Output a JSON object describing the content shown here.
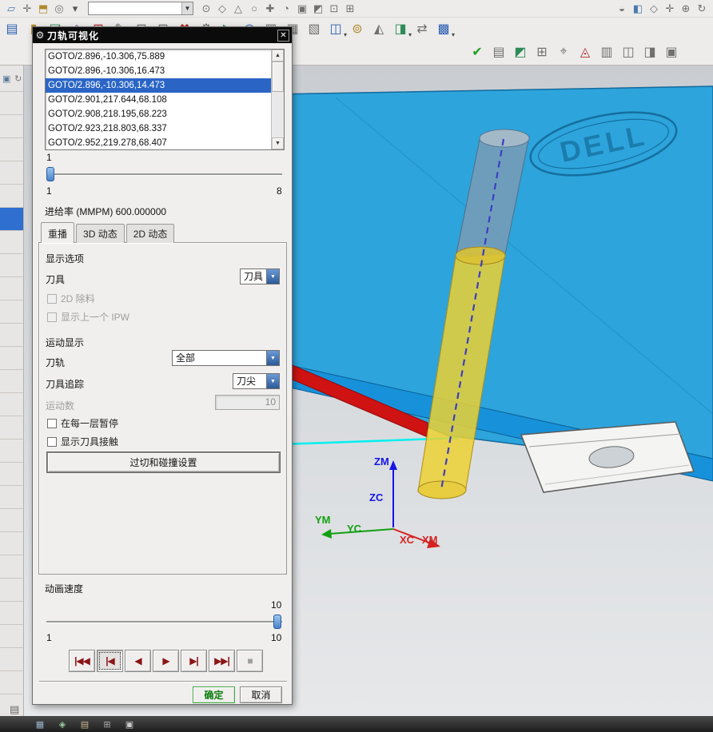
{
  "toolbars": {
    "row1_combo_value": "",
    "row1_left": [
      {
        "name": "sketch-icon",
        "glyph": "▱",
        "color": "#4a7ab0"
      },
      {
        "name": "datum-csys-icon",
        "glyph": "✛",
        "color": "#707070"
      },
      {
        "name": "extrude-icon",
        "glyph": "⬒",
        "color": "#b08a30"
      },
      {
        "name": "hole-icon",
        "glyph": "◎",
        "color": "#707070"
      },
      {
        "name": "feature-more-icon",
        "glyph": "▾",
        "color": "#555"
      }
    ],
    "row1_mid": [
      {
        "name": "snap-point-icon",
        "glyph": "⊙",
        "color": "#707070"
      },
      {
        "name": "snap-endpoint-icon",
        "glyph": "◇",
        "color": "#707070"
      },
      {
        "name": "snap-midpoint-icon",
        "glyph": "△",
        "color": "#707070"
      },
      {
        "name": "snap-center-icon",
        "glyph": "○",
        "color": "#707070"
      },
      {
        "name": "snap-intersection-icon",
        "glyph": "✚",
        "color": "#707070"
      },
      {
        "name": "snap-quadrant-icon",
        "glyph": "◔",
        "color": "#707070"
      },
      {
        "name": "snap-node-icon",
        "glyph": "▣",
        "color": "#707070"
      },
      {
        "name": "snap-edge-icon",
        "glyph": "◩",
        "color": "#707070"
      },
      {
        "name": "snap-face-icon",
        "glyph": "⊡",
        "color": "#707070"
      },
      {
        "name": "snap-grid-icon",
        "glyph": "⊞",
        "color": "#707070"
      }
    ],
    "row1_right": [
      {
        "name": "orient-view-icon",
        "glyph": "◒",
        "color": "#707070"
      },
      {
        "name": "shaded-view-icon",
        "glyph": "◧",
        "color": "#4a7ab0"
      },
      {
        "name": "wireframe-view-icon",
        "glyph": "◇",
        "color": "#707070"
      },
      {
        "name": "pan-icon",
        "glyph": "✛",
        "color": "#707070"
      },
      {
        "name": "zoom-icon",
        "glyph": "⊕",
        "color": "#707070"
      },
      {
        "name": "rotate-view-icon",
        "glyph": "↻",
        "color": "#707070"
      }
    ],
    "row2": [
      {
        "name": "create-program-icon",
        "glyph": "▤",
        "color": "#2b5fb4"
      },
      {
        "name": "create-tool-icon",
        "glyph": "▮",
        "color": "#b08a30"
      },
      {
        "name": "create-geometry-icon",
        "glyph": "◪",
        "color": "#2e8b57"
      },
      {
        "name": "create-method-icon",
        "glyph": "◈",
        "color": "#8a4ab0"
      },
      {
        "name": "create-operation-icon",
        "glyph": "⊞",
        "color": "#b03030"
      },
      {
        "name": "edit-object-icon",
        "glyph": "✎",
        "color": "#707070"
      },
      {
        "name": "copy-object-icon",
        "glyph": "⊟",
        "color": "#707070"
      },
      {
        "name": "paste-object-icon",
        "glyph": "⊡",
        "color": "#707070"
      },
      {
        "name": "delete-object-icon",
        "glyph": "✖",
        "color": "#b03030"
      },
      {
        "name": "generate-toolpath-icon",
        "glyph": "⚙",
        "color": "#707070"
      },
      {
        "name": "verify-toolpath-icon",
        "glyph": "▶",
        "color": "#2e8b57",
        "caret": true
      },
      {
        "name": "simulate-machine-icon",
        "glyph": "◉",
        "color": "#2b5fb4"
      },
      {
        "name": "postprocess-icon",
        "glyph": "▥",
        "color": "#707070"
      },
      {
        "name": "shop-documentation-icon",
        "glyph": "▦",
        "color": "#707070"
      },
      {
        "name": "list-toolpath-icon",
        "glyph": "▧",
        "color": "#707070"
      },
      {
        "name": "machine-sim-icon",
        "glyph": "◫",
        "color": "#2b5fb4",
        "caret": true
      },
      {
        "name": "feeds-speeds-icon",
        "glyph": "⊚",
        "color": "#b08a30"
      },
      {
        "name": "tool-display-icon",
        "glyph": "◭",
        "color": "#707070"
      },
      {
        "name": "workpiece-icon",
        "glyph": "◨",
        "color": "#2e8b57",
        "caret": true
      },
      {
        "name": "transform-path-icon",
        "glyph": "⇄",
        "color": "#707070"
      },
      {
        "name": "output-cls-icon",
        "glyph": "▩",
        "color": "#2b5fb4",
        "caret": true
      }
    ],
    "row3": [
      {
        "name": "accept-icon",
        "glyph": "✔",
        "color": "#1e9e1e"
      },
      {
        "name": "layer-settings-icon",
        "glyph": "▤",
        "color": "#707070"
      },
      {
        "name": "group-icon",
        "glyph": "◩",
        "color": "#2e8b57"
      },
      {
        "name": "grid-icon",
        "glyph": "⊞",
        "color": "#707070"
      },
      {
        "name": "target-point-icon",
        "glyph": "⌖",
        "color": "#707070"
      },
      {
        "name": "flag-icon",
        "glyph": "◬",
        "color": "#b03030"
      },
      {
        "name": "note-icon",
        "glyph": "▥",
        "color": "#707070"
      },
      {
        "name": "info-icon",
        "glyph": "◫",
        "color": "#707070"
      },
      {
        "name": "measure-icon",
        "glyph": "◨",
        "color": "#707070"
      },
      {
        "name": "display-mode-icon",
        "glyph": "▣",
        "color": "#707070"
      }
    ]
  },
  "sidebar": {
    "row_count": 27,
    "selected_row": 5,
    "header_icons": [
      {
        "name": "roles-icon",
        "glyph": "▣",
        "color": "#5a7a9a"
      },
      {
        "name": "history-icon",
        "glyph": "↻",
        "color": "#777777"
      }
    ]
  },
  "statusbar": {
    "icons": [
      {
        "name": "status-select-icon",
        "glyph": "▦",
        "color": "#9ab4cc"
      },
      {
        "name": "status-snap-icon",
        "glyph": "◈",
        "color": "#9acc9a"
      },
      {
        "name": "status-layer-icon",
        "glyph": "▤",
        "color": "#ccb48a"
      },
      {
        "name": "status-grid-icon",
        "glyph": "⊞",
        "color": "#aaaaaa"
      },
      {
        "name": "status-message-icon",
        "glyph": "▣",
        "color": "#cccccc"
      }
    ]
  },
  "dialog": {
    "title": "刀轨可视化",
    "goto_lines": [
      "GOTO/2.896,-10.306,75.889",
      "GOTO/2.896,-10.306,16.473",
      "GOTO/2.896,-10.306,14.473",
      "GOTO/2.901,217.644,68.108",
      "GOTO/2.908,218.195,68.223",
      "GOTO/2.923,218.803,68.337",
      "GOTO/2.952,219.278,68.407"
    ],
    "selected_index": 2,
    "progress_slider": {
      "current": "1",
      "min": "1",
      "max": "8"
    },
    "feedrate_label": "进给率 (MMPM) 600.000000",
    "tabs": [
      {
        "label": "重播",
        "active": true
      },
      {
        "label": "3D 动态",
        "active": false
      },
      {
        "label": "2D 动态",
        "active": false
      }
    ],
    "display_options_label": "显示选项",
    "tool_row_label": "刀具",
    "tool_combo_value": "刀具",
    "checkbox_2d_label": "2D 除料",
    "checkbox_ipw_label": "显示上一个 IPW",
    "motion_display_label": "运动显示",
    "toolpath_label": "刀轨",
    "toolpath_combo_value": "全部",
    "tool_track_label": "刀具追踪",
    "tool_track_combo_value": "刀尖",
    "motion_count_label": "运动数",
    "motion_count_value": "10",
    "checkbox_pause_label": "在每一层暂停",
    "checkbox_contact_label": "显示刀具接触",
    "collision_button_label": "过切和碰撞设置",
    "anim_speed_label": "动画速度",
    "speed_slider": {
      "current": "10",
      "min": "1",
      "max": "10"
    },
    "playback": [
      {
        "name": "go-to-start-button",
        "glyph": "|◀◀"
      },
      {
        "name": "step-back-button",
        "glyph": "|◀",
        "focused": true
      },
      {
        "name": "play-backward-button",
        "glyph": "◀"
      },
      {
        "name": "play-forward-button",
        "glyph": "▶"
      },
      {
        "name": "step-forward-button",
        "glyph": "▶|"
      },
      {
        "name": "go-to-end-button",
        "glyph": "▶▶|"
      },
      {
        "name": "stop-button",
        "glyph": "■",
        "disabled": true
      }
    ],
    "ok_label": "确定",
    "cancel_label": "取消"
  },
  "viewport": {
    "logo": "DELL",
    "axes": {
      "zm": "ZM",
      "zc": "ZC",
      "ym": "YM",
      "yc": "YC",
      "xc": "XC",
      "xm": "XM"
    }
  }
}
